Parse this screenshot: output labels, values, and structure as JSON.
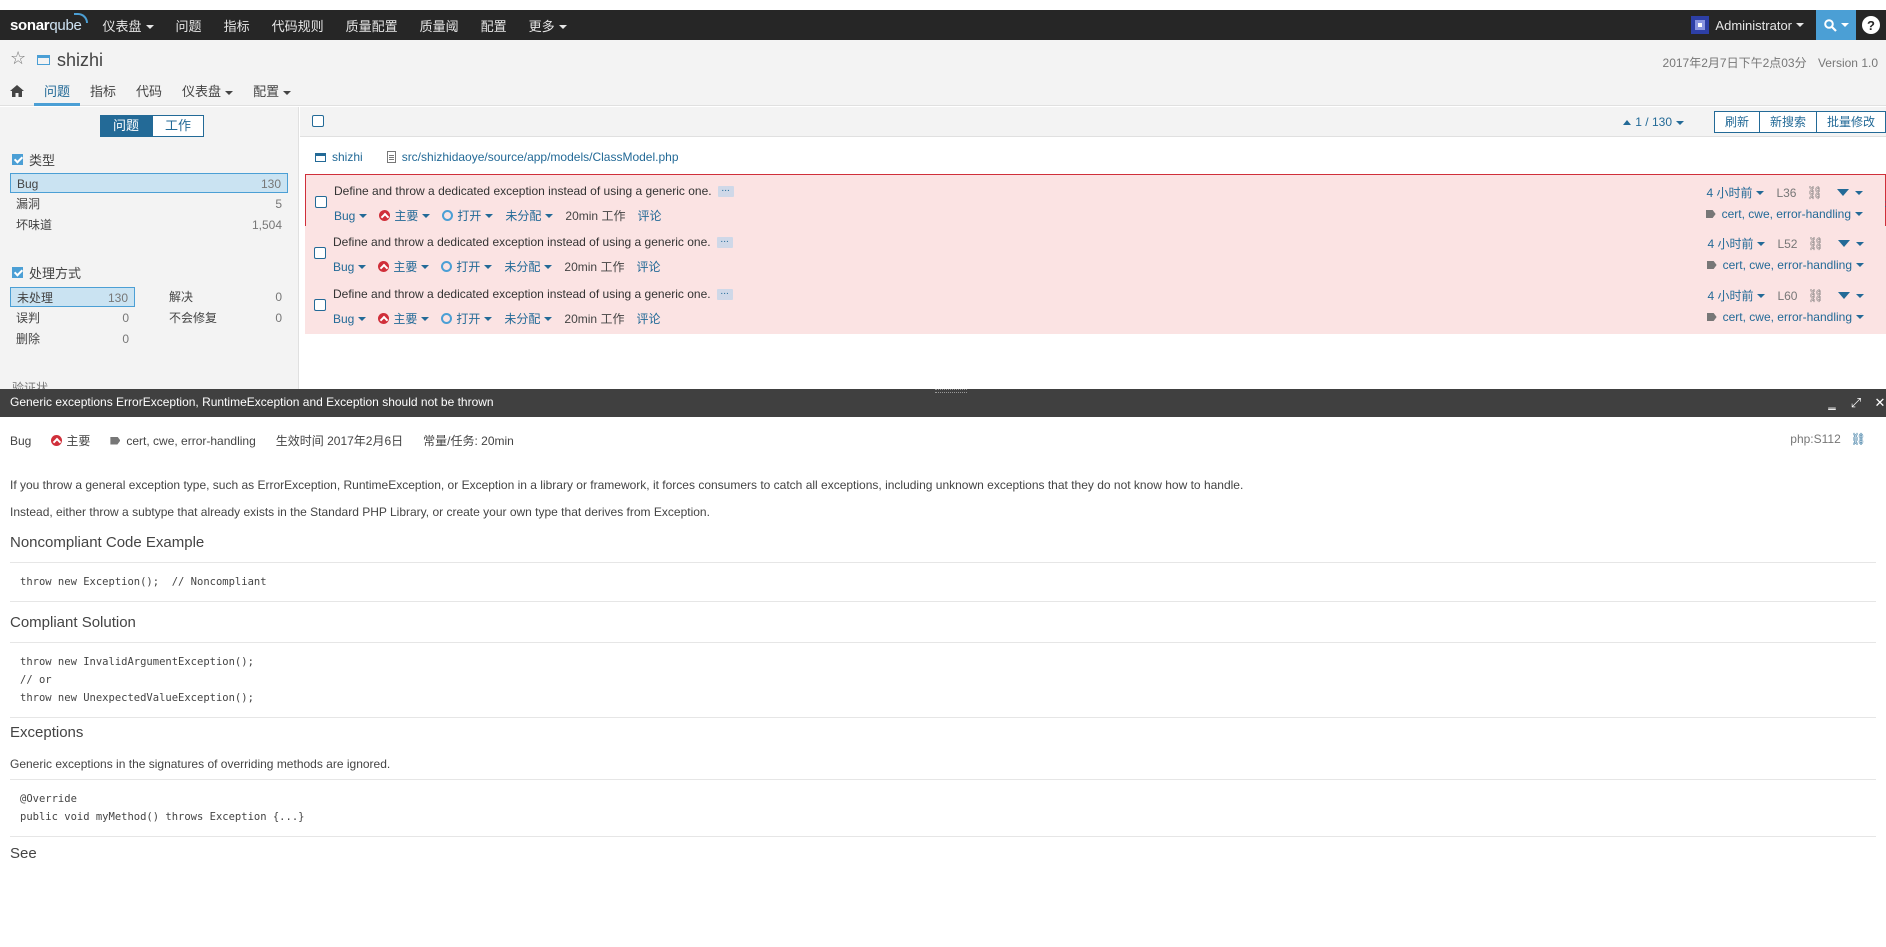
{
  "browser": {
    "bookmark_fragments": [
      "",
      "",
      "",
      "",
      "",
      ""
    ]
  },
  "topnav": {
    "logo_a": "sonar",
    "logo_b": "qube",
    "items": [
      "仪表盘",
      "问题",
      "指标",
      "代码规则",
      "质量配置",
      "质量阈",
      "配置",
      "更多"
    ],
    "user": "Administrator",
    "help": "?"
  },
  "project": {
    "name": "shizhi",
    "date": "2017年2月7日下午2点03分",
    "version": "Version 1.0",
    "tabs": [
      "问题",
      "指标",
      "代码",
      "仪表盘",
      "配置"
    ]
  },
  "sidebar": {
    "mode": [
      "问题",
      "工作"
    ],
    "type_title": "类型",
    "types": [
      {
        "label": "Bug",
        "count": "130"
      },
      {
        "label": "漏洞",
        "count": "5"
      },
      {
        "label": "坏味道",
        "count": "1,504"
      }
    ],
    "resolution_title": "处理方式",
    "resolutions": [
      {
        "label": "未处理",
        "count": "130"
      },
      {
        "label": "解决",
        "count": "0"
      },
      {
        "label": "误判",
        "count": "0"
      },
      {
        "label": "不会修复",
        "count": "0"
      },
      {
        "label": "删除",
        "count": "0"
      }
    ],
    "cut_label": "验证状"
  },
  "toolbar": {
    "pager": "1 / 130",
    "buttons": [
      "刷新",
      "新搜索",
      "批量修改"
    ]
  },
  "component": {
    "project": "shizhi",
    "file": "src/shizhidaoye/source/app/models/ClassModel.php"
  },
  "issues": [
    {
      "message": "Define and throw a dedicated exception instead of using a generic one.",
      "type": "Bug",
      "severity": "主要",
      "status": "打开",
      "assignee": "未分配",
      "effort": "20min",
      "effort_unit": "工作",
      "comment": "评论",
      "age": "4 小时前",
      "line": "L36",
      "tags": "cert, cwe, error-handling"
    },
    {
      "message": "Define and throw a dedicated exception instead of using a generic one.",
      "type": "Bug",
      "severity": "主要",
      "status": "打开",
      "assignee": "未分配",
      "effort": "20min",
      "effort_unit": "工作",
      "comment": "评论",
      "age": "4 小时前",
      "line": "L52",
      "tags": "cert, cwe, error-handling"
    },
    {
      "message": "Define and throw a dedicated exception instead of using a generic one.",
      "type": "Bug",
      "severity": "主要",
      "status": "打开",
      "assignee": "未分配",
      "effort": "20min",
      "effort_unit": "工作",
      "comment": "评论",
      "age": "4 小时前",
      "line": "L60",
      "tags": "cert, cwe, error-handling"
    }
  ],
  "rule": {
    "title": "Generic exceptions ErrorException, RuntimeException and Exception should not be thrown",
    "type": "Bug",
    "severity": "主要",
    "tags": "cert, cwe, error-handling",
    "effective": "生效时间 2017年2月6日",
    "constant": "常量/任务: 20min",
    "key": "php:S112",
    "p1": "If you throw a general exception type, such as ErrorException, RuntimeException, or Exception in a library or framework, it forces consumers to catch all exceptions, including unknown exceptions that they do not know how to handle.",
    "p2": "Instead, either throw a subtype that already exists in the Standard PHP Library, or create your own type that derives from Exception.",
    "h_noncompliant": "Noncompliant Code Example",
    "code_noncompliant": "throw new Exception();  // Noncompliant",
    "h_compliant": "Compliant Solution",
    "code_compliant": "throw new InvalidArgumentException();\n// or\nthrow new UnexpectedValueException();",
    "h_exceptions": "Exceptions",
    "p3": "Generic exceptions in the signatures of overriding methods are ignored.",
    "code_exceptions": "@Override\npublic void myMethod() throws Exception {...}",
    "h_see": "See"
  }
}
